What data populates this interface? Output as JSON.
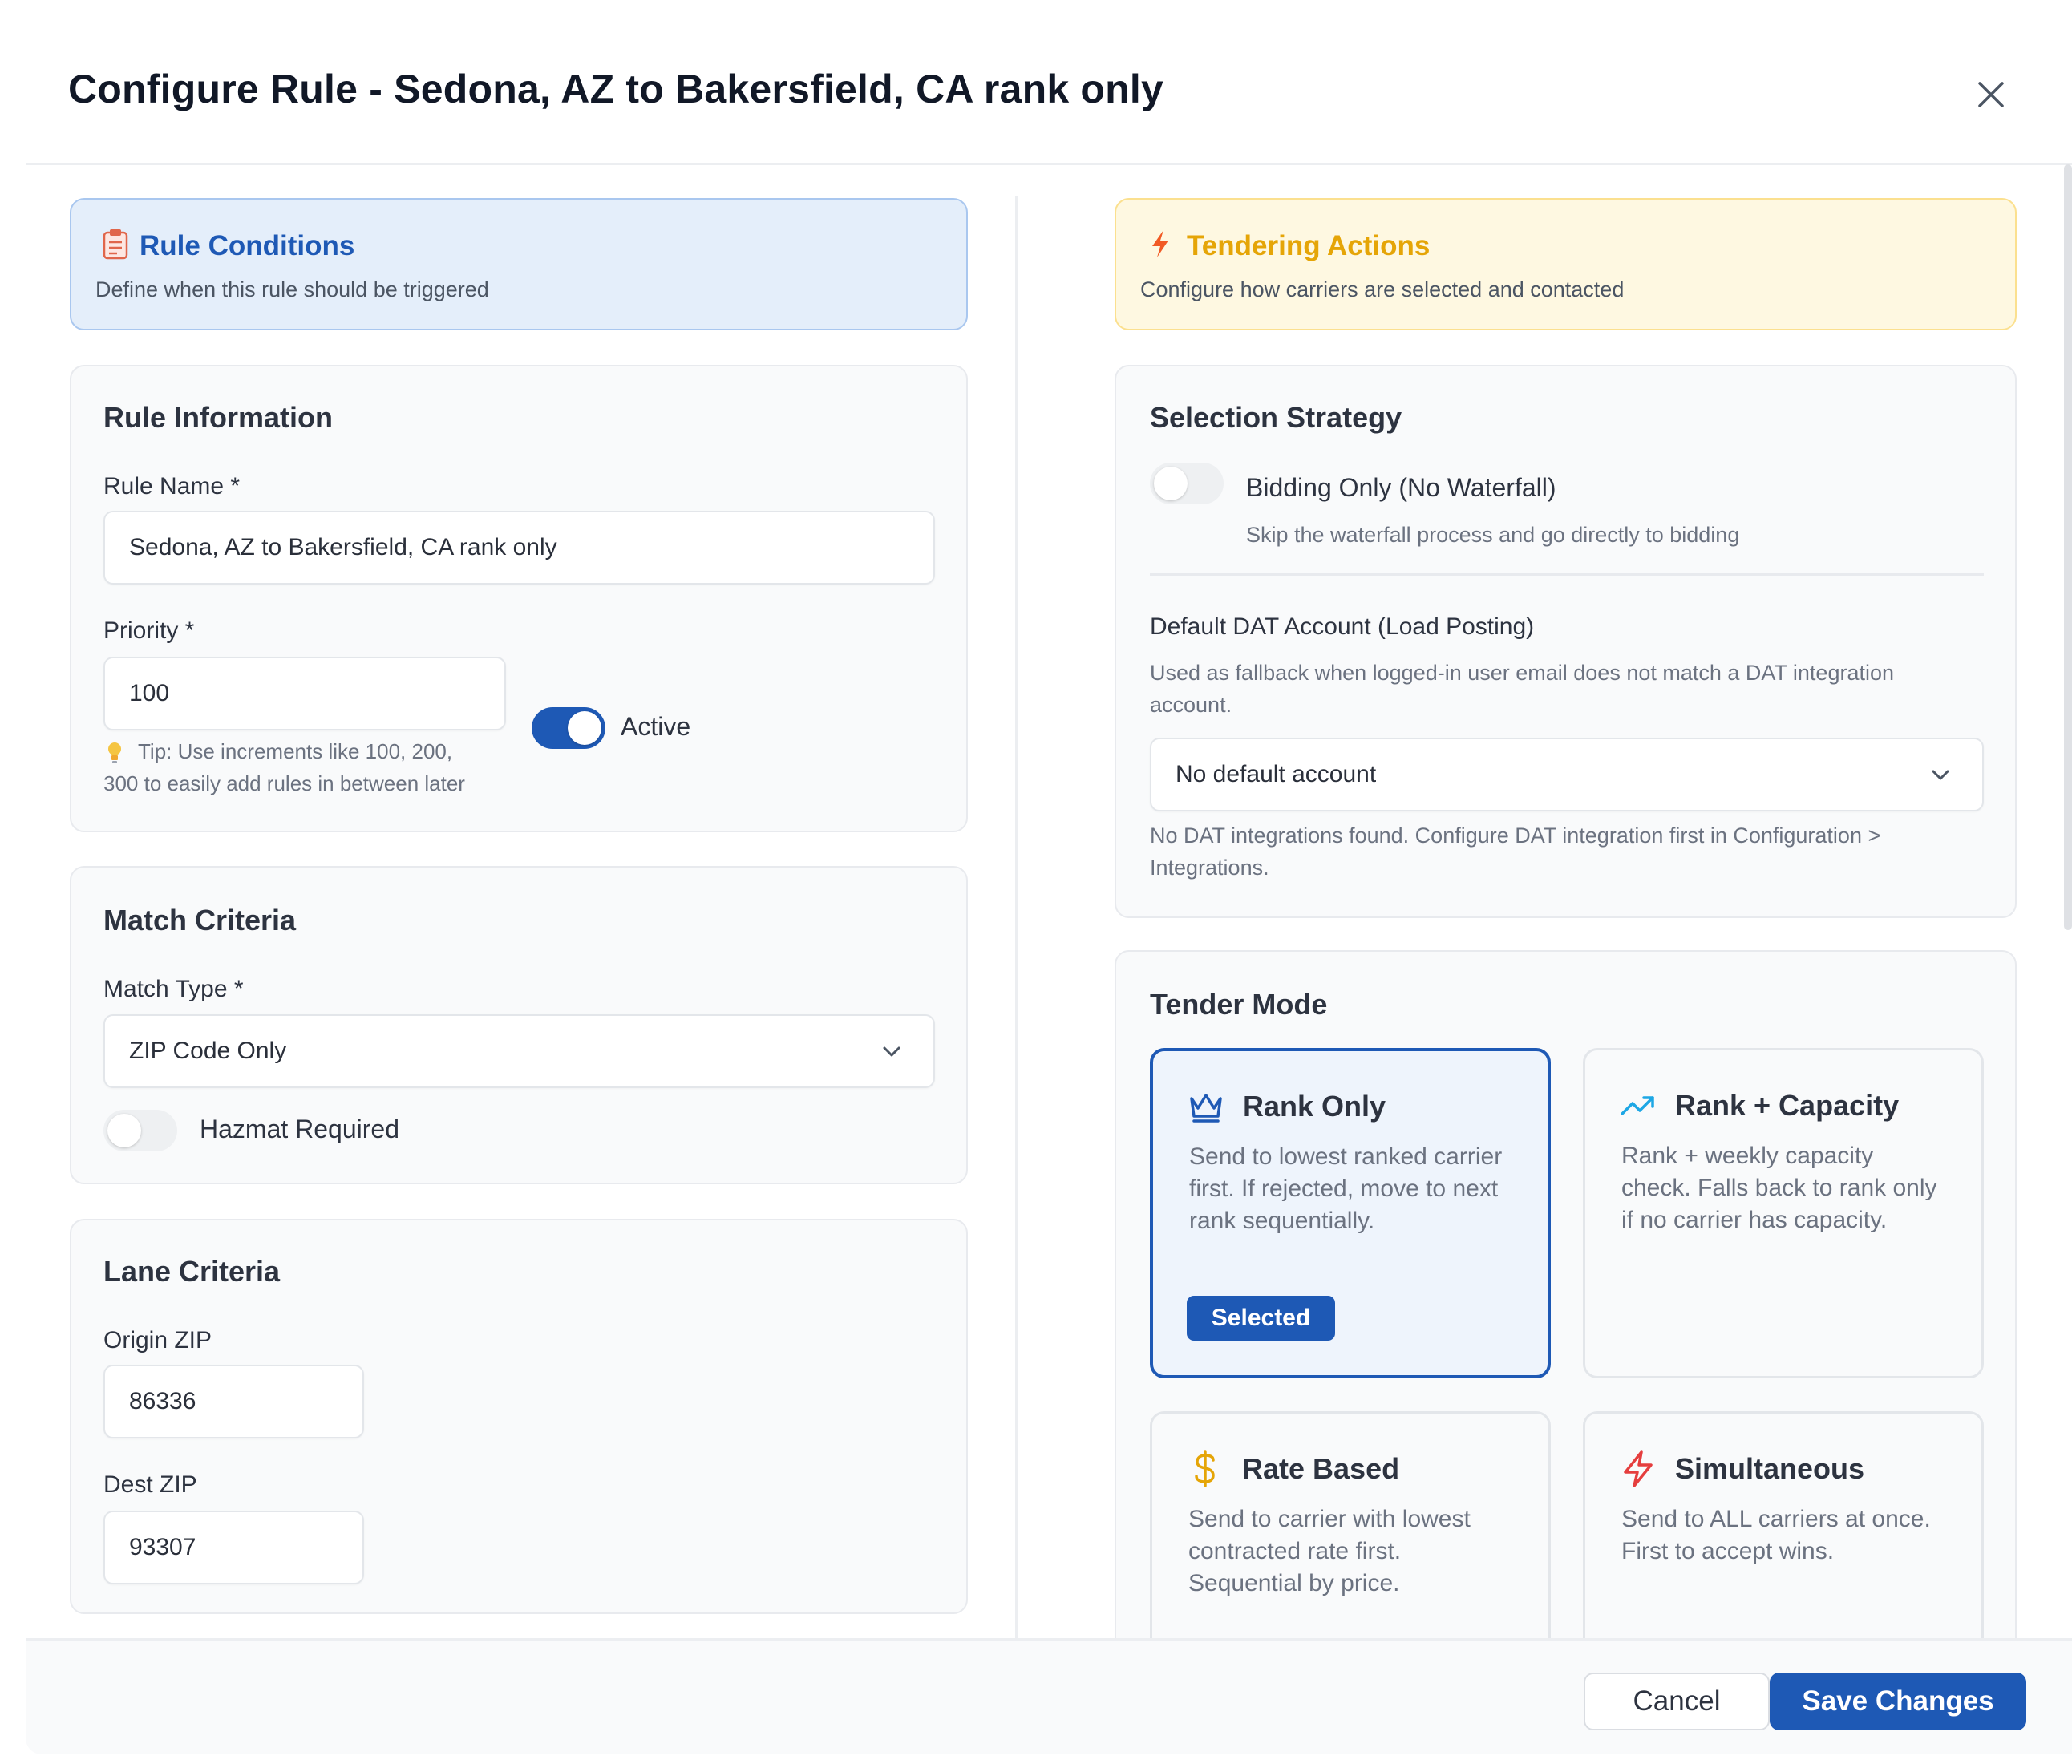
{
  "dialog": {
    "title": "Configure Rule - Sedona, AZ to Bakersfield, CA rank only"
  },
  "left": {
    "banner": {
      "title": "Rule Conditions",
      "subtitle": "Define when this rule should be triggered"
    },
    "rule_info": {
      "title": "Rule Information",
      "name_label": "Rule Name *",
      "name_value": "Sedona, AZ to Bakersfield, CA rank only",
      "priority_label": "Priority *",
      "priority_value": "100",
      "tip_line1": "Tip: Use increments like 100, 200,",
      "tip_line2": "300 to easily add rules in between later",
      "active_label": "Active",
      "active": true
    },
    "match": {
      "title": "Match Criteria",
      "type_label": "Match Type *",
      "type_value": "ZIP Code Only",
      "hazmat_label": "Hazmat Required",
      "hazmat": false
    },
    "lane": {
      "title": "Lane Criteria",
      "origin_label": "Origin ZIP",
      "origin_value": "86336",
      "dest_label": "Dest ZIP",
      "dest_value": "93307"
    }
  },
  "right": {
    "banner": {
      "title": "Tendering Actions",
      "subtitle": "Configure how carriers are selected and contacted"
    },
    "strategy": {
      "title": "Selection Strategy",
      "bidding_label": "Bidding Only (No Waterfall)",
      "bidding_hint": "Skip the waterfall process and go directly to bidding",
      "bidding": false,
      "dat_label": "Default DAT Account (Load Posting)",
      "dat_hint_line1": "Used as fallback when logged-in user email does not match a DAT integration",
      "dat_hint_line2": "account.",
      "dat_value": "No default account",
      "dat_note_line1": "No DAT integrations found. Configure DAT integration first in Configuration >",
      "dat_note_line2": "Integrations."
    },
    "tender": {
      "title": "Tender Mode",
      "modes": [
        {
          "title": "Rank Only",
          "desc": "Send to lowest ranked carrier first. If rejected, move to next rank sequentially.",
          "icon": "crown-icon",
          "selected": true,
          "badge": "Selected"
        },
        {
          "title": "Rank + Capacity",
          "desc": "Rank + weekly capacity check. Falls back to rank only if no carrier has capacity.",
          "icon": "trending-up-icon",
          "selected": false
        },
        {
          "title": "Rate Based",
          "desc": "Send to carrier with lowest contracted rate first. Sequential by price.",
          "icon": "dollar-icon",
          "selected": false
        },
        {
          "title": "Simultaneous",
          "desc": "Send to ALL carriers at once. First to accept wins.",
          "icon": "lightning-icon",
          "selected": false
        }
      ]
    }
  },
  "footer": {
    "cancel_label": "Cancel",
    "save_label": "Save Changes"
  },
  "colors": {
    "primary": "#1e59b5",
    "yellow_accent": "#e5a507",
    "red_accent": "#e53e3e"
  }
}
